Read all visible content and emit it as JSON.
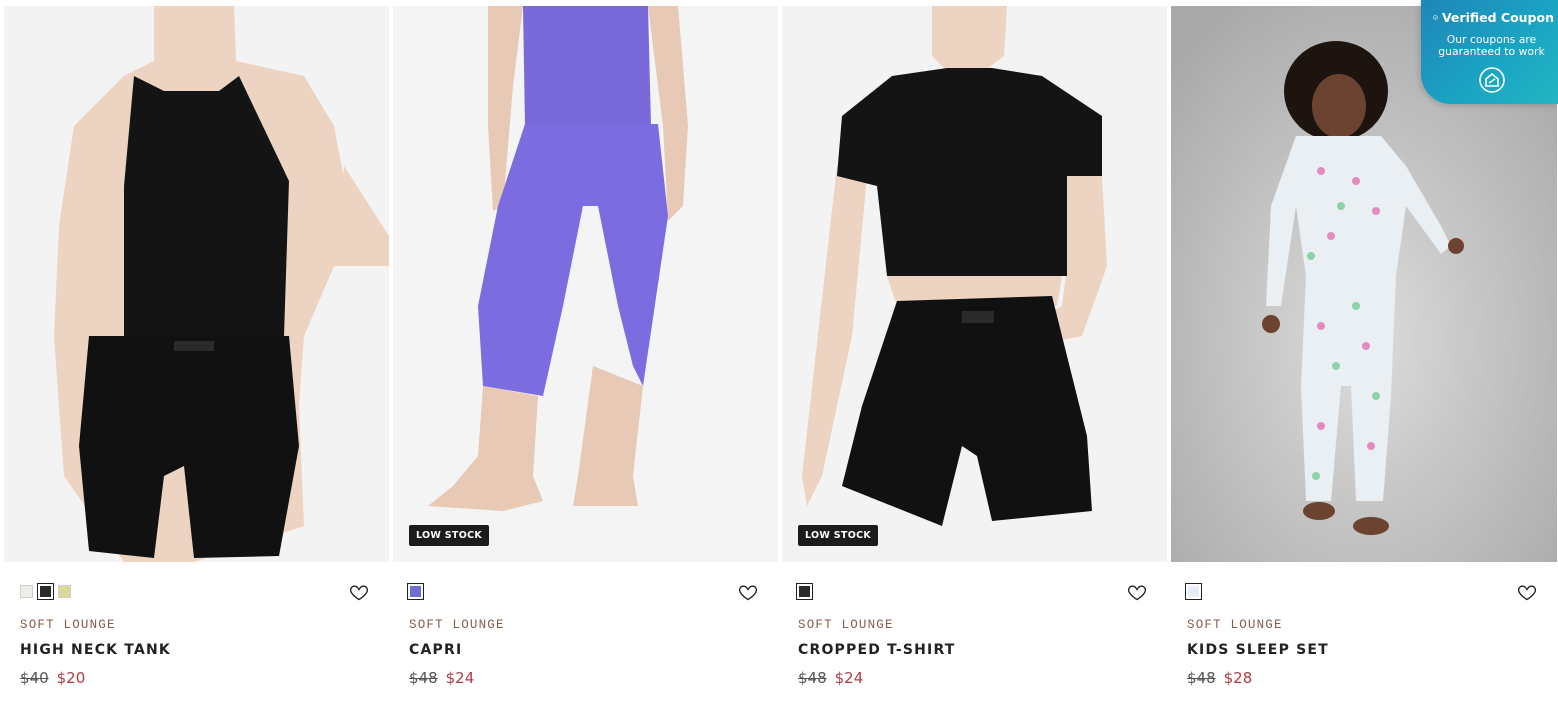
{
  "products": [
    {
      "collection": "SOFT LOUNGE",
      "name": "HIGH NECK TANK",
      "original_price": "$40",
      "sale_price": "$20",
      "badge": "",
      "swatch_colors": [
        "#eeeee8",
        "#2a2a2a",
        "#d9d99a"
      ],
      "selected_swatch": 1,
      "favorite_icon": "heart-outline-icon"
    },
    {
      "collection": "SOFT LOUNGE",
      "name": "CAPRI",
      "original_price": "$48",
      "sale_price": "$24",
      "badge": "LOW STOCK",
      "swatch_colors": [
        "#6f6fd0"
      ],
      "selected_swatch": 0,
      "favorite_icon": "heart-outline-icon"
    },
    {
      "collection": "SOFT LOUNGE",
      "name": "CROPPED T-SHIRT",
      "original_price": "$48",
      "sale_price": "$24",
      "badge": "LOW STOCK",
      "swatch_colors": [
        "#2a2a2a"
      ],
      "selected_swatch": 0,
      "favorite_icon": "heart-outline-icon"
    },
    {
      "collection": "SOFT LOUNGE",
      "name": "KIDS SLEEP SET",
      "original_price": "$48",
      "sale_price": "$28",
      "badge": "",
      "swatch_colors": [
        "#e6eef7"
      ],
      "selected_swatch": 0,
      "favorite_icon": "heart-outline-icon"
    }
  ],
  "coupon": {
    "title": "Verified Coupon",
    "line1": "Our coupons are",
    "line2": "guaranteed to work",
    "icon": "coupon-logo-icon"
  },
  "colors": {
    "collection_text": "#8a5a4e",
    "sale_price": "#b23a48",
    "badge_bg": "#1c1c1c",
    "coupon_bg": "#1a9cc0"
  }
}
